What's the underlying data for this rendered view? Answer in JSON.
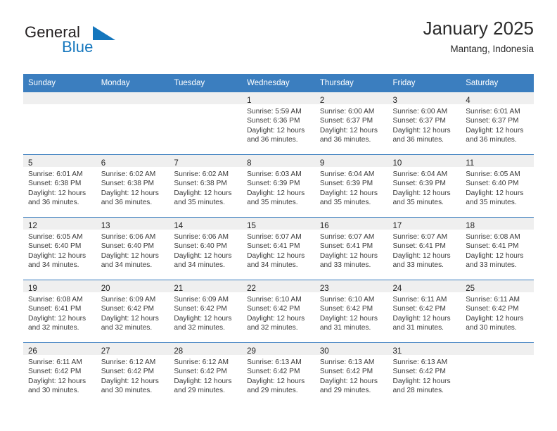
{
  "brand": {
    "line1": "General",
    "line2": "Blue",
    "mark": "triangle-logo-mark",
    "color_dark": "#231f20",
    "color_blue": "#1476bd"
  },
  "header": {
    "title": "January 2025",
    "subtitle": "Mantang, Indonesia"
  },
  "theme": {
    "header_bg": "#3b7ebf",
    "daynum_band": "#efefef",
    "row_border": "#3b7ebf",
    "text": "#3a3a3a"
  },
  "weekday_headers": [
    "Sunday",
    "Monday",
    "Tuesday",
    "Wednesday",
    "Thursday",
    "Friday",
    "Saturday"
  ],
  "weeks": [
    [
      {
        "day": "",
        "lines": []
      },
      {
        "day": "",
        "lines": []
      },
      {
        "day": "",
        "lines": []
      },
      {
        "day": "1",
        "lines": [
          "Sunrise: 5:59 AM",
          "Sunset: 6:36 PM",
          "Daylight: 12 hours",
          "and 36 minutes."
        ]
      },
      {
        "day": "2",
        "lines": [
          "Sunrise: 6:00 AM",
          "Sunset: 6:37 PM",
          "Daylight: 12 hours",
          "and 36 minutes."
        ]
      },
      {
        "day": "3",
        "lines": [
          "Sunrise: 6:00 AM",
          "Sunset: 6:37 PM",
          "Daylight: 12 hours",
          "and 36 minutes."
        ]
      },
      {
        "day": "4",
        "lines": [
          "Sunrise: 6:01 AM",
          "Sunset: 6:37 PM",
          "Daylight: 12 hours",
          "and 36 minutes."
        ]
      }
    ],
    [
      {
        "day": "5",
        "lines": [
          "Sunrise: 6:01 AM",
          "Sunset: 6:38 PM",
          "Daylight: 12 hours",
          "and 36 minutes."
        ]
      },
      {
        "day": "6",
        "lines": [
          "Sunrise: 6:02 AM",
          "Sunset: 6:38 PM",
          "Daylight: 12 hours",
          "and 36 minutes."
        ]
      },
      {
        "day": "7",
        "lines": [
          "Sunrise: 6:02 AM",
          "Sunset: 6:38 PM",
          "Daylight: 12 hours",
          "and 35 minutes."
        ]
      },
      {
        "day": "8",
        "lines": [
          "Sunrise: 6:03 AM",
          "Sunset: 6:39 PM",
          "Daylight: 12 hours",
          "and 35 minutes."
        ]
      },
      {
        "day": "9",
        "lines": [
          "Sunrise: 6:04 AM",
          "Sunset: 6:39 PM",
          "Daylight: 12 hours",
          "and 35 minutes."
        ]
      },
      {
        "day": "10",
        "lines": [
          "Sunrise: 6:04 AM",
          "Sunset: 6:39 PM",
          "Daylight: 12 hours",
          "and 35 minutes."
        ]
      },
      {
        "day": "11",
        "lines": [
          "Sunrise: 6:05 AM",
          "Sunset: 6:40 PM",
          "Daylight: 12 hours",
          "and 35 minutes."
        ]
      }
    ],
    [
      {
        "day": "12",
        "lines": [
          "Sunrise: 6:05 AM",
          "Sunset: 6:40 PM",
          "Daylight: 12 hours",
          "and 34 minutes."
        ]
      },
      {
        "day": "13",
        "lines": [
          "Sunrise: 6:06 AM",
          "Sunset: 6:40 PM",
          "Daylight: 12 hours",
          "and 34 minutes."
        ]
      },
      {
        "day": "14",
        "lines": [
          "Sunrise: 6:06 AM",
          "Sunset: 6:40 PM",
          "Daylight: 12 hours",
          "and 34 minutes."
        ]
      },
      {
        "day": "15",
        "lines": [
          "Sunrise: 6:07 AM",
          "Sunset: 6:41 PM",
          "Daylight: 12 hours",
          "and 34 minutes."
        ]
      },
      {
        "day": "16",
        "lines": [
          "Sunrise: 6:07 AM",
          "Sunset: 6:41 PM",
          "Daylight: 12 hours",
          "and 33 minutes."
        ]
      },
      {
        "day": "17",
        "lines": [
          "Sunrise: 6:07 AM",
          "Sunset: 6:41 PM",
          "Daylight: 12 hours",
          "and 33 minutes."
        ]
      },
      {
        "day": "18",
        "lines": [
          "Sunrise: 6:08 AM",
          "Sunset: 6:41 PM",
          "Daylight: 12 hours",
          "and 33 minutes."
        ]
      }
    ],
    [
      {
        "day": "19",
        "lines": [
          "Sunrise: 6:08 AM",
          "Sunset: 6:41 PM",
          "Daylight: 12 hours",
          "and 32 minutes."
        ]
      },
      {
        "day": "20",
        "lines": [
          "Sunrise: 6:09 AM",
          "Sunset: 6:42 PM",
          "Daylight: 12 hours",
          "and 32 minutes."
        ]
      },
      {
        "day": "21",
        "lines": [
          "Sunrise: 6:09 AM",
          "Sunset: 6:42 PM",
          "Daylight: 12 hours",
          "and 32 minutes."
        ]
      },
      {
        "day": "22",
        "lines": [
          "Sunrise: 6:10 AM",
          "Sunset: 6:42 PM",
          "Daylight: 12 hours",
          "and 32 minutes."
        ]
      },
      {
        "day": "23",
        "lines": [
          "Sunrise: 6:10 AM",
          "Sunset: 6:42 PM",
          "Daylight: 12 hours",
          "and 31 minutes."
        ]
      },
      {
        "day": "24",
        "lines": [
          "Sunrise: 6:11 AM",
          "Sunset: 6:42 PM",
          "Daylight: 12 hours",
          "and 31 minutes."
        ]
      },
      {
        "day": "25",
        "lines": [
          "Sunrise: 6:11 AM",
          "Sunset: 6:42 PM",
          "Daylight: 12 hours",
          "and 30 minutes."
        ]
      }
    ],
    [
      {
        "day": "26",
        "lines": [
          "Sunrise: 6:11 AM",
          "Sunset: 6:42 PM",
          "Daylight: 12 hours",
          "and 30 minutes."
        ]
      },
      {
        "day": "27",
        "lines": [
          "Sunrise: 6:12 AM",
          "Sunset: 6:42 PM",
          "Daylight: 12 hours",
          "and 30 minutes."
        ]
      },
      {
        "day": "28",
        "lines": [
          "Sunrise: 6:12 AM",
          "Sunset: 6:42 PM",
          "Daylight: 12 hours",
          "and 29 minutes."
        ]
      },
      {
        "day": "29",
        "lines": [
          "Sunrise: 6:13 AM",
          "Sunset: 6:42 PM",
          "Daylight: 12 hours",
          "and 29 minutes."
        ]
      },
      {
        "day": "30",
        "lines": [
          "Sunrise: 6:13 AM",
          "Sunset: 6:42 PM",
          "Daylight: 12 hours",
          "and 29 minutes."
        ]
      },
      {
        "day": "31",
        "lines": [
          "Sunrise: 6:13 AM",
          "Sunset: 6:42 PM",
          "Daylight: 12 hours",
          "and 28 minutes."
        ]
      },
      {
        "day": "",
        "lines": []
      }
    ]
  ]
}
